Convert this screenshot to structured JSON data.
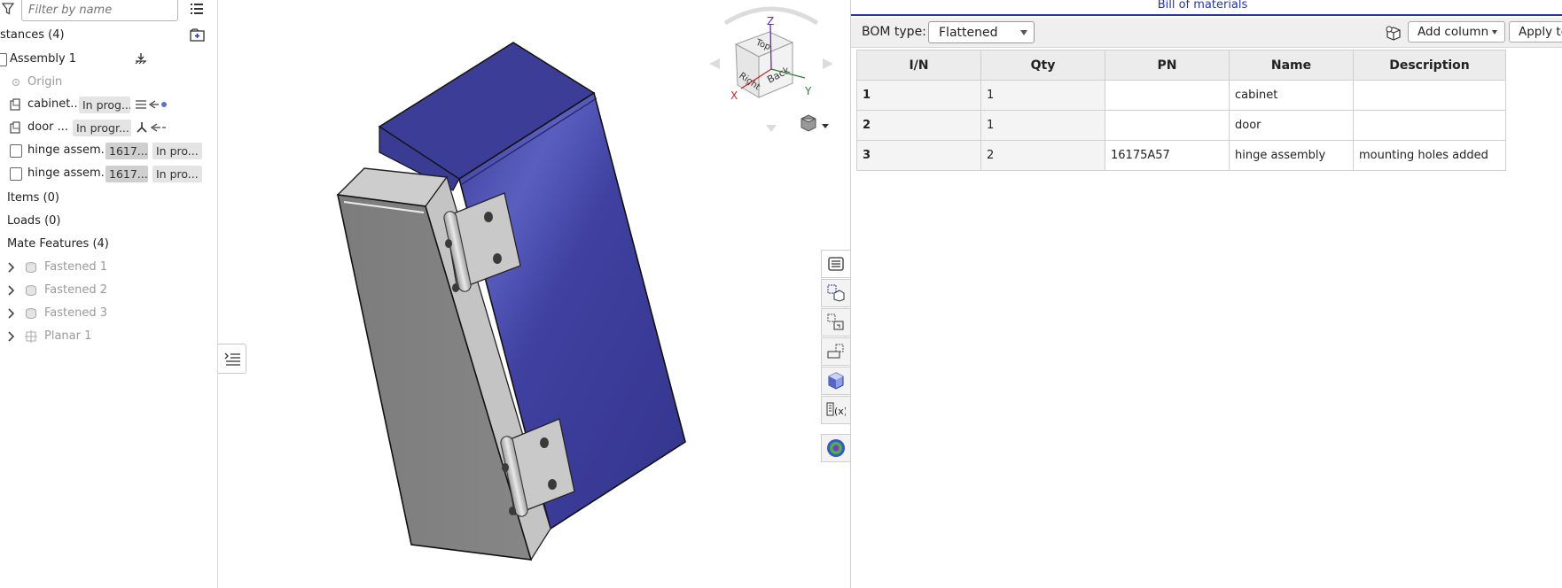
{
  "tree": {
    "filter_placeholder": "Filter by name",
    "instances_label": "stances (4)",
    "assembly_label": "Assembly 1",
    "origin_label": "Origin",
    "instances": [
      {
        "name": "cabinet...",
        "status": "In prog..."
      },
      {
        "name": "door ...",
        "status": "In progr..."
      },
      {
        "name": "hinge assem...",
        "pn": "1617...",
        "status": "In pro..."
      },
      {
        "name": "hinge assem...",
        "pn": "1617...",
        "status": "In pro..."
      }
    ],
    "items_label": "Items (0)",
    "loads_label": "Loads (0)",
    "mates_label": "Mate Features (4)",
    "mates": [
      {
        "label": "Fastened 1"
      },
      {
        "label": "Fastened 2"
      },
      {
        "label": "Fastened 3"
      },
      {
        "label": "Planar 1"
      }
    ]
  },
  "navcube": {
    "face_top": "Top",
    "face_right": "Right",
    "face_back": "Back",
    "axis_x": "X",
    "axis_y": "Y",
    "axis_z": "Z"
  },
  "bom": {
    "title": "Bill of materials",
    "type_label": "BOM type:",
    "type_value": "Flattened",
    "add_column_label": "Add column",
    "apply_template_label": "Apply ter",
    "columns": [
      "I/N",
      "Qty",
      "PN",
      "Name",
      "Description"
    ],
    "rows": [
      [
        "1",
        "1",
        "",
        "cabinet",
        ""
      ],
      [
        "2",
        "1",
        "",
        "door",
        ""
      ],
      [
        "3",
        "2",
        "16175A57",
        "hinge assembly",
        "mounting holes added"
      ]
    ]
  },
  "colors": {
    "cabinet_blue": "#3e3f9c",
    "door_grey": "#808080",
    "bom_title": "#2633a6"
  }
}
